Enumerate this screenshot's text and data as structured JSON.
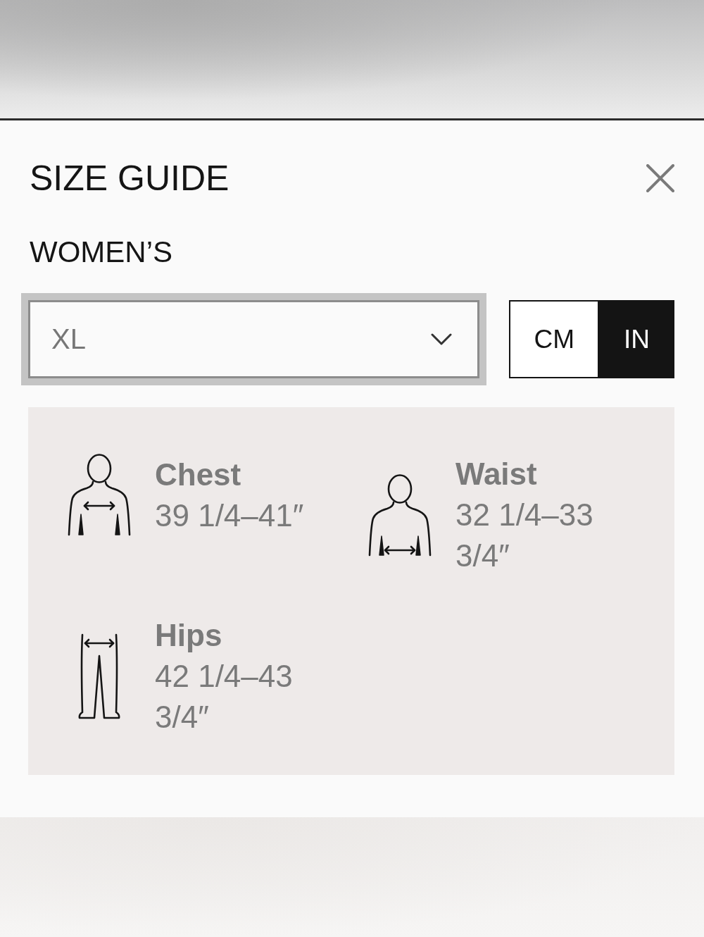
{
  "dialog": {
    "title": "SIZE GUIDE"
  },
  "heading": "WOMEN’S",
  "size_select": {
    "value": "XL",
    "focused": true
  },
  "units": [
    {
      "label": "CM",
      "selected": false
    },
    {
      "label": "IN",
      "selected": true
    }
  ],
  "measurements": [
    {
      "kind": "chest",
      "label": "Chest",
      "value": "39 1/4–41″"
    },
    {
      "kind": "waist",
      "label": "Waist",
      "value": "32 1/4–33 3/4″"
    },
    {
      "kind": "hips",
      "label": "Hips",
      "value": "42 1/4–43 3/4″"
    }
  ]
}
